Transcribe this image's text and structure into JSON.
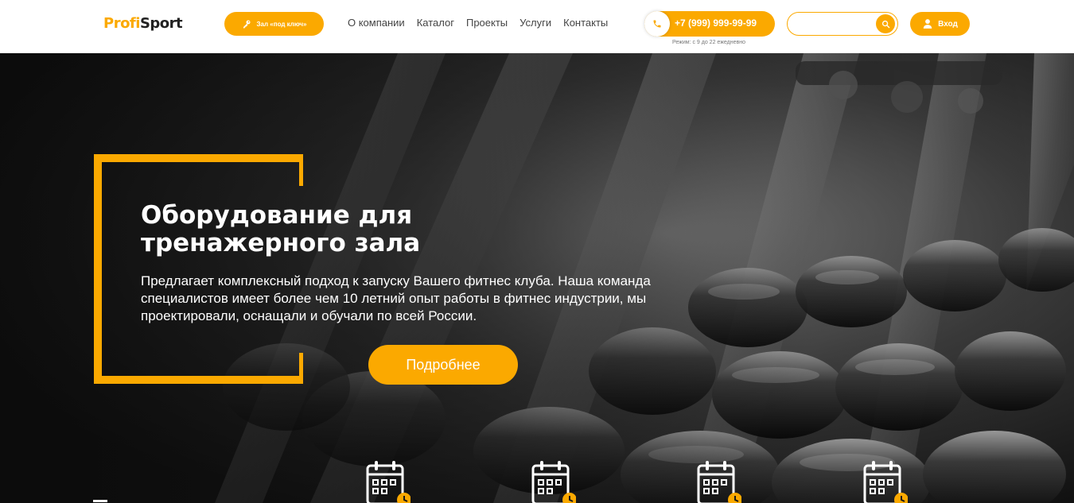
{
  "header": {
    "logo": {
      "part1": "Profi",
      "part2": "Sport"
    },
    "turnkey_button": "Зал «под ключ»",
    "nav": [
      {
        "label": "О компании"
      },
      {
        "label": "Каталог"
      },
      {
        "label": "Проекты"
      },
      {
        "label": "Услуги"
      },
      {
        "label": "Контакты"
      }
    ],
    "phone": "+7 (999) 999-99-99",
    "hours": "Режим: с 9 до 22 ежедневно",
    "search": {
      "value": "",
      "placeholder": ""
    },
    "login_button": "Вход"
  },
  "hero": {
    "title": "Оборудование для тренажерного зала",
    "description": "Предлагает комплексный подход к запуску Вашего фитнес клуба. Наша команда специалистов имеет более чем 10 летний опыт работы в фитнес индустрии, мы проектировали, оснащали и обучали по всей России.",
    "button": "Подробнее"
  },
  "features": [
    {
      "icon": "calendar-clock-icon"
    },
    {
      "icon": "calendar-clock-icon"
    },
    {
      "icon": "calendar-clock-icon"
    },
    {
      "icon": "calendar-clock-icon"
    }
  ],
  "colors": {
    "accent": "#fba900",
    "text_dark": "#444444",
    "hero_text": "#ffffff"
  }
}
